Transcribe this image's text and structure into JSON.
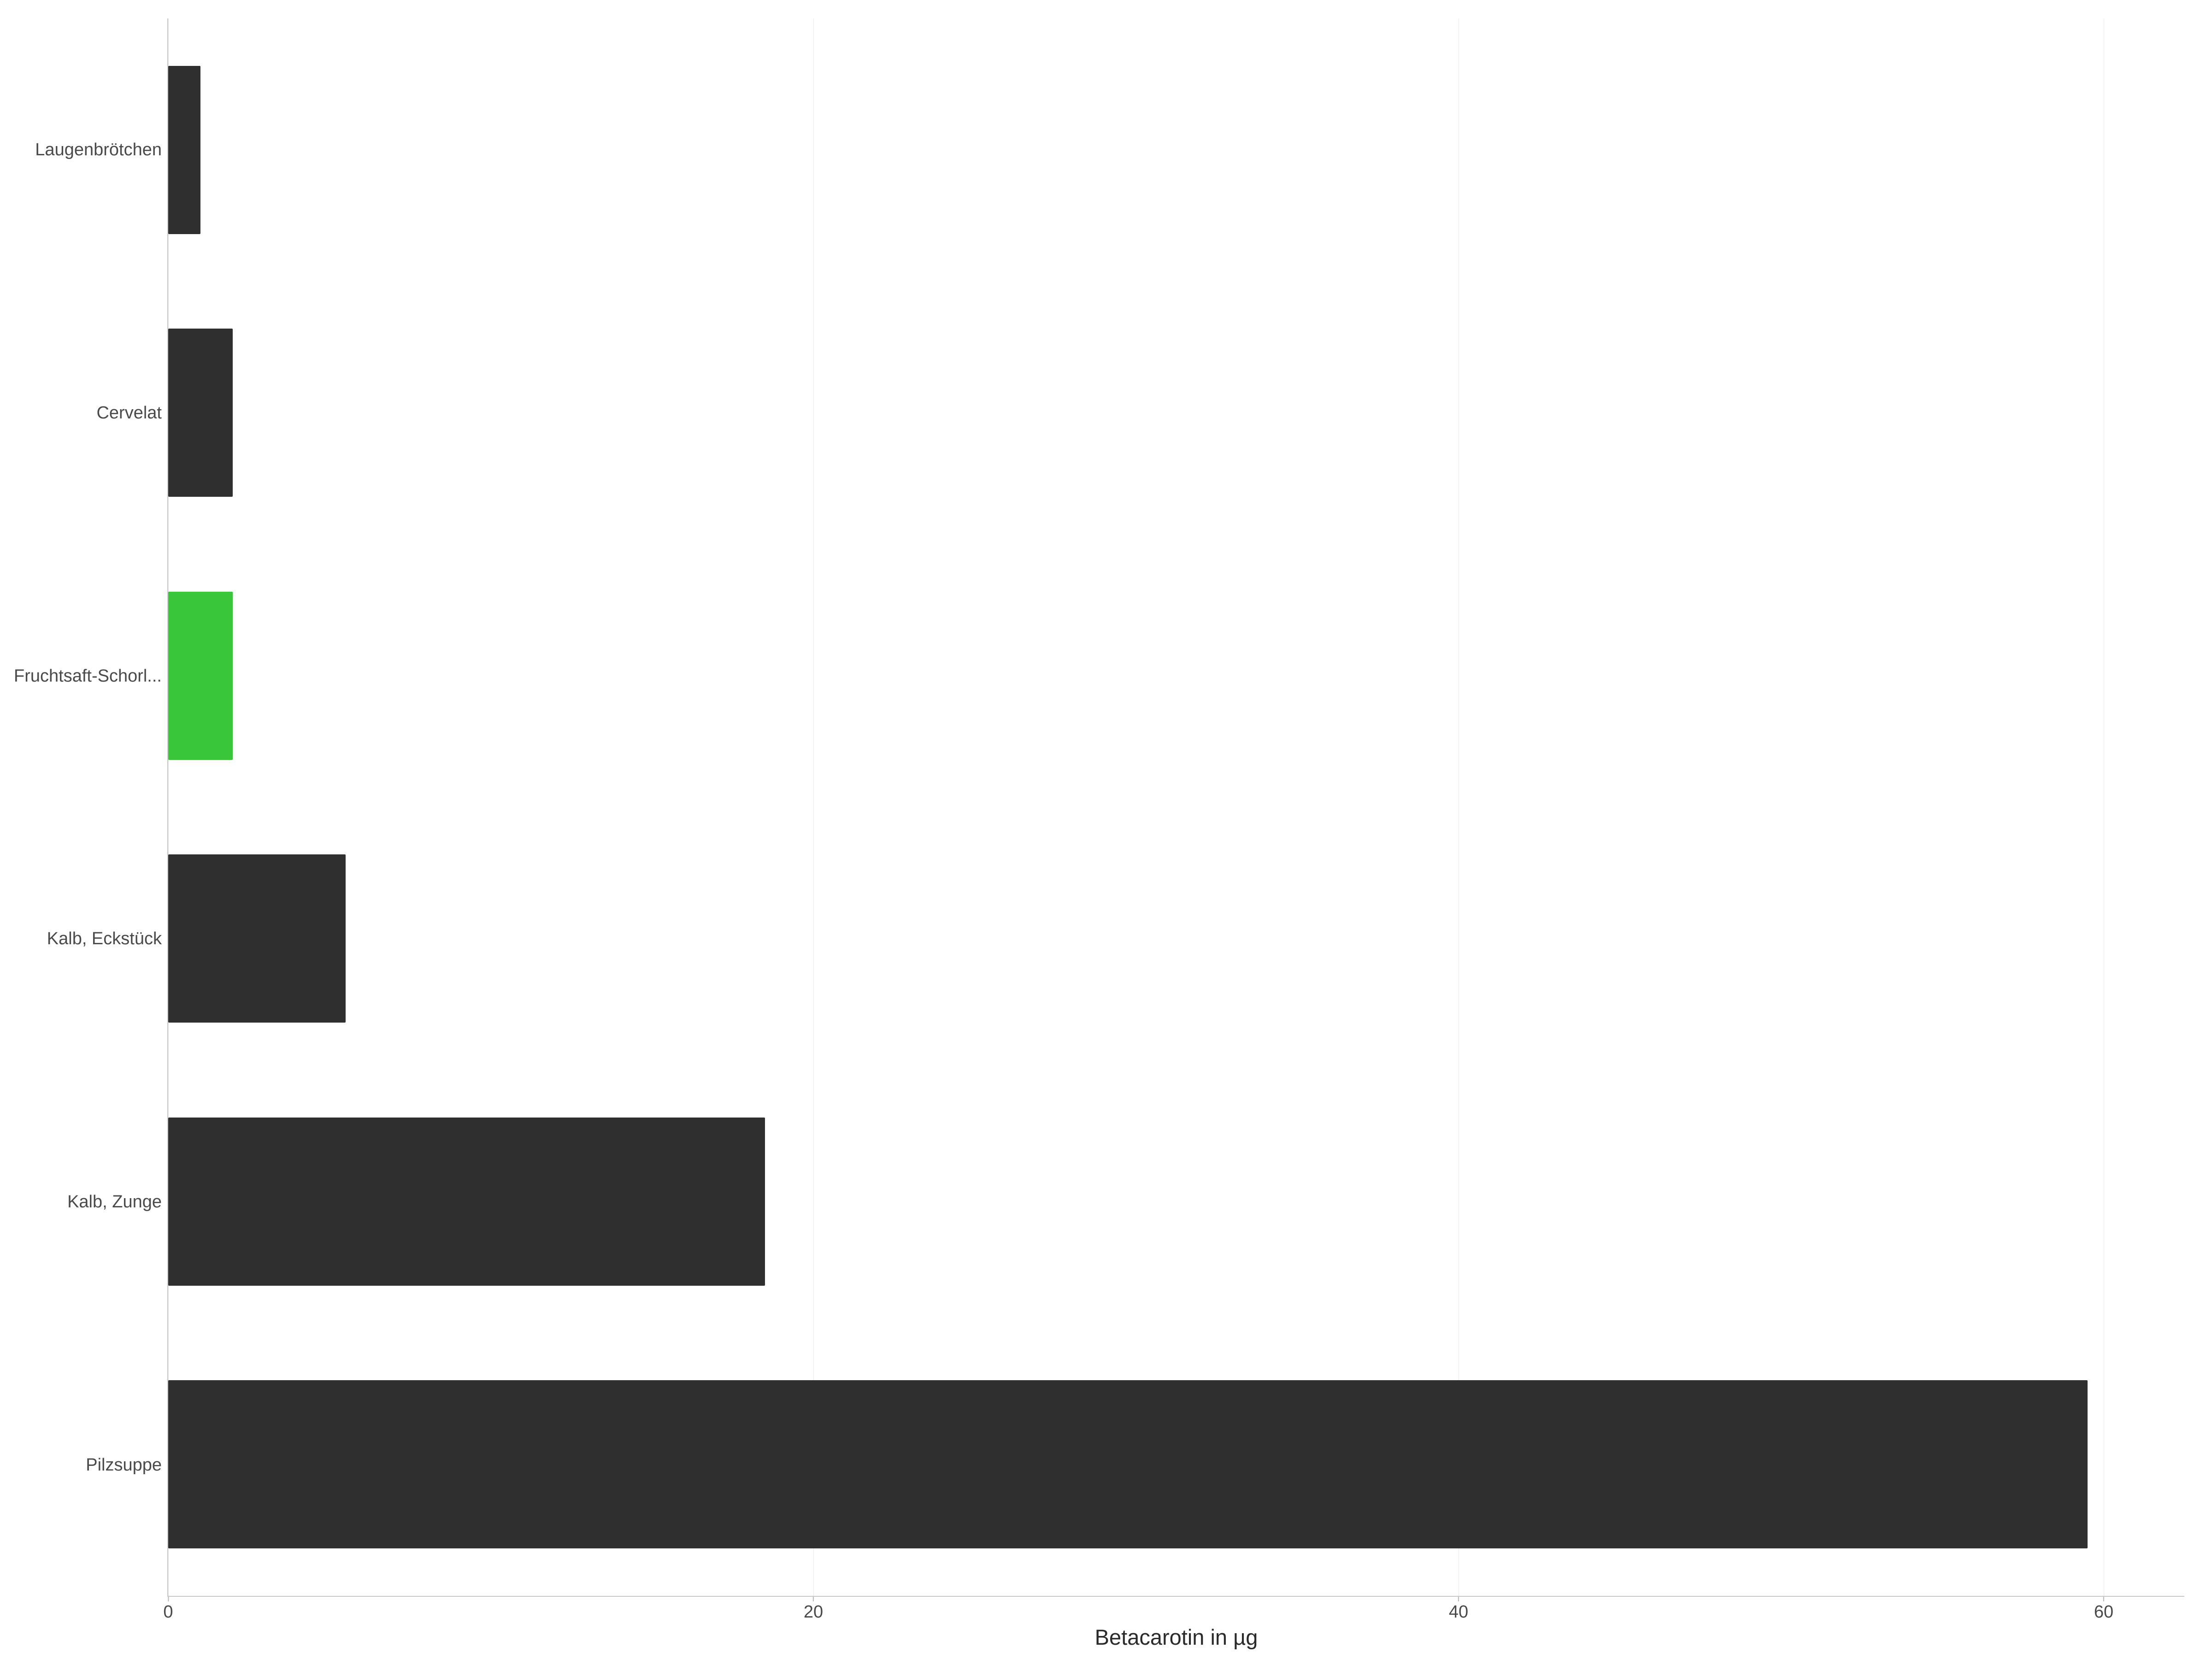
{
  "chart_data": {
    "type": "bar",
    "orientation": "horizontal",
    "categories": [
      "Laugenbrötchen",
      "Cervelat",
      "Fruchtsaft-Schorl...",
      "Kalb, Eckstück",
      "Kalb, Zunge",
      "Pilzsuppe"
    ],
    "values": [
      1.0,
      2.0,
      2.0,
      5.5,
      18.5,
      59.5
    ],
    "highlight_index": 2,
    "xlabel": "Betacarotin in µg",
    "ylabel": "",
    "title": "",
    "xlim": [
      0,
      62.5
    ],
    "x_ticks": [
      0,
      20,
      40,
      60
    ],
    "colors": {
      "default": "#2f2f2f",
      "highlight": "#3ac63a"
    }
  },
  "axis": {
    "x_tick_labels": [
      "0",
      "20",
      "40",
      "60"
    ],
    "x_title": "Betacarotin in µg"
  },
  "labels": {
    "cat0": "Laugenbrötchen",
    "cat1": "Cervelat",
    "cat2": "Fruchtsaft-Schorl...",
    "cat3": "Kalb, Eckstück",
    "cat4": "Kalb, Zunge",
    "cat5": "Pilzsuppe"
  }
}
